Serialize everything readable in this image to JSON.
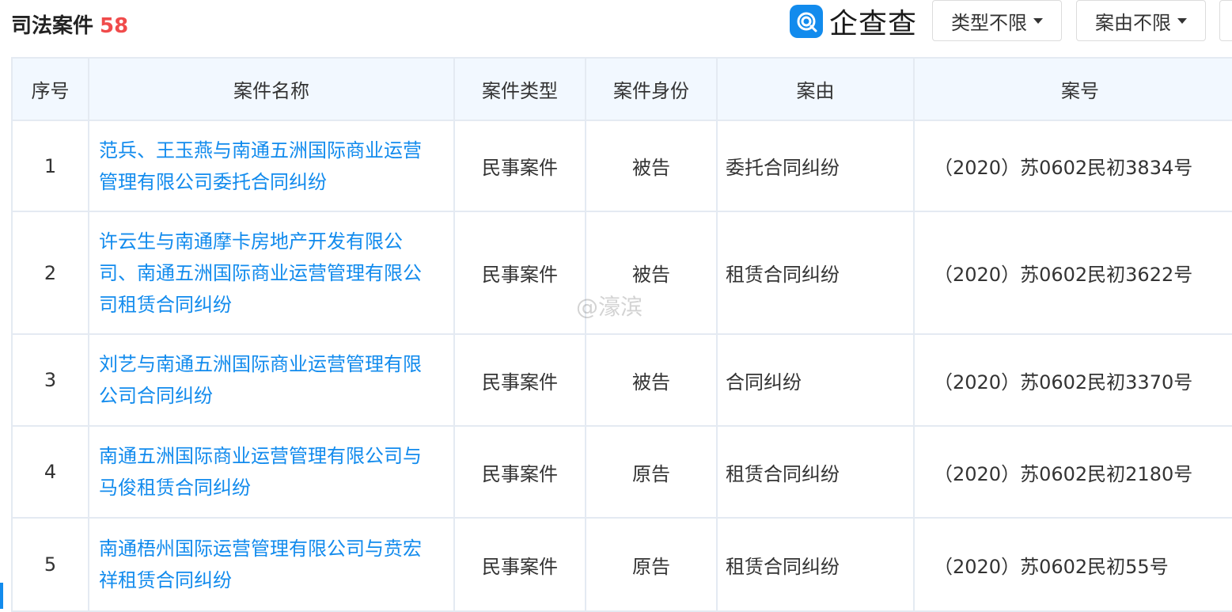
{
  "header": {
    "title": "司法案件",
    "count": "58",
    "logo_text": "企查查",
    "filters": {
      "type_label": "类型不限",
      "reason_label": "案由不限"
    }
  },
  "table": {
    "columns": [
      "序号",
      "案件名称",
      "案件类型",
      "案件身份",
      "案由",
      "案号"
    ],
    "rows": [
      {
        "index": "1",
        "name_lines": [
          "范兵、王玉燕与南通五洲国际商业运营",
          "管理有限公司委托合同纠纷"
        ],
        "type": "民事案件",
        "role": "被告",
        "reason": "委托合同纠纷",
        "case_no": "（2020）苏0602民初3834号"
      },
      {
        "index": "2",
        "name_lines": [
          "许云生与南通摩卡房地产开发有限公",
          "司、南通五洲国际商业运营管理有限公",
          "司租赁合同纠纷"
        ],
        "type": "民事案件",
        "role": "被告",
        "reason": "租赁合同纠纷",
        "case_no": "（2020）苏0602民初3622号"
      },
      {
        "index": "3",
        "name_lines": [
          "刘艺与南通五洲国际商业运营管理有限",
          "公司合同纠纷"
        ],
        "type": "民事案件",
        "role": "被告",
        "reason": "合同纠纷",
        "case_no": "（2020）苏0602民初3370号"
      },
      {
        "index": "4",
        "name_lines": [
          "南通五洲国际商业运营管理有限公司与",
          "马俊租赁合同纠纷"
        ],
        "type": "民事案件",
        "role": "原告",
        "reason": "租赁合同纠纷",
        "case_no": "（2020）苏0602民初2180号"
      },
      {
        "index": "5",
        "name_lines": [
          "南通梧州国际运营管理有限公司与贲宏",
          "祥租赁合同纠纷"
        ],
        "type": "民事案件",
        "role": "原告",
        "reason": "租赁合同纠纷",
        "case_no": "（2020）苏0602民初55号"
      }
    ]
  },
  "watermark": "@濠滨",
  "colors": {
    "accent": "#128bed",
    "count": "#f04b4b",
    "header_bg": "#f2f8ff",
    "border": "#e4eaf2"
  }
}
